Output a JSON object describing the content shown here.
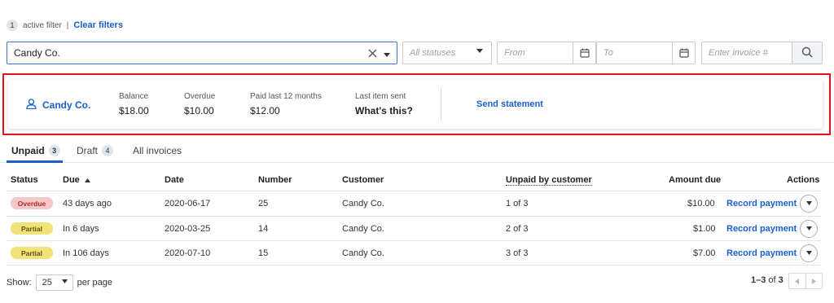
{
  "filters": {
    "active_count": "1",
    "active_label": "active filter",
    "separator": "|",
    "clear_label": "Clear filters",
    "customer_value": "Candy Co.",
    "status_placeholder": "All statuses",
    "from_placeholder": "From",
    "to_placeholder": "To",
    "invoice_placeholder": "Enter invoice #"
  },
  "customer_card": {
    "name": "Candy Co.",
    "balance_label": "Balance",
    "balance_value": "$18.00",
    "overdue_label": "Overdue",
    "overdue_value": "$10.00",
    "paid_label": "Paid last 12 months",
    "paid_value": "$12.00",
    "last_item_label": "Last item sent",
    "last_item_link": "What's this?",
    "send_statement": "Send statement"
  },
  "tabs": [
    {
      "label": "Unpaid",
      "count": "3"
    },
    {
      "label": "Draft",
      "count": "4"
    },
    {
      "label": "All invoices"
    }
  ],
  "table": {
    "headers": {
      "status": "Status",
      "due": "Due",
      "date": "Date",
      "number": "Number",
      "customer": "Customer",
      "unpaid_by_customer": "Unpaid by customer",
      "amount_due": "Amount due",
      "actions": "Actions"
    },
    "rows": [
      {
        "status": "Overdue",
        "due": "43 days ago",
        "date": "2020-06-17",
        "number": "25",
        "customer": "Candy Co.",
        "unpaid": "1 of 3",
        "amount": "$10.00",
        "action": "Record payment"
      },
      {
        "status": "Partial",
        "due": "In 6 days",
        "date": "2020-03-25",
        "number": "14",
        "customer": "Candy Co.",
        "unpaid": "2 of 3",
        "amount": "$1.00",
        "action": "Record payment"
      },
      {
        "status": "Partial",
        "due": "In 106 days",
        "date": "2020-07-10",
        "number": "15",
        "customer": "Candy Co.",
        "unpaid": "3 of 3",
        "amount": "$7.00",
        "action": "Record payment"
      }
    ]
  },
  "footer": {
    "show_label": "Show:",
    "per_page_value": "25",
    "per_page_label": "per page",
    "range": "1–3",
    "of_label": "of",
    "total": "3"
  },
  "colors": {
    "accent": "#1a5fd0",
    "overdue_text": "#d93b3b",
    "highlight_border": "#e0141a",
    "partial_badge": "#f1e27a",
    "overdue_badge": "#f5c9ca"
  }
}
